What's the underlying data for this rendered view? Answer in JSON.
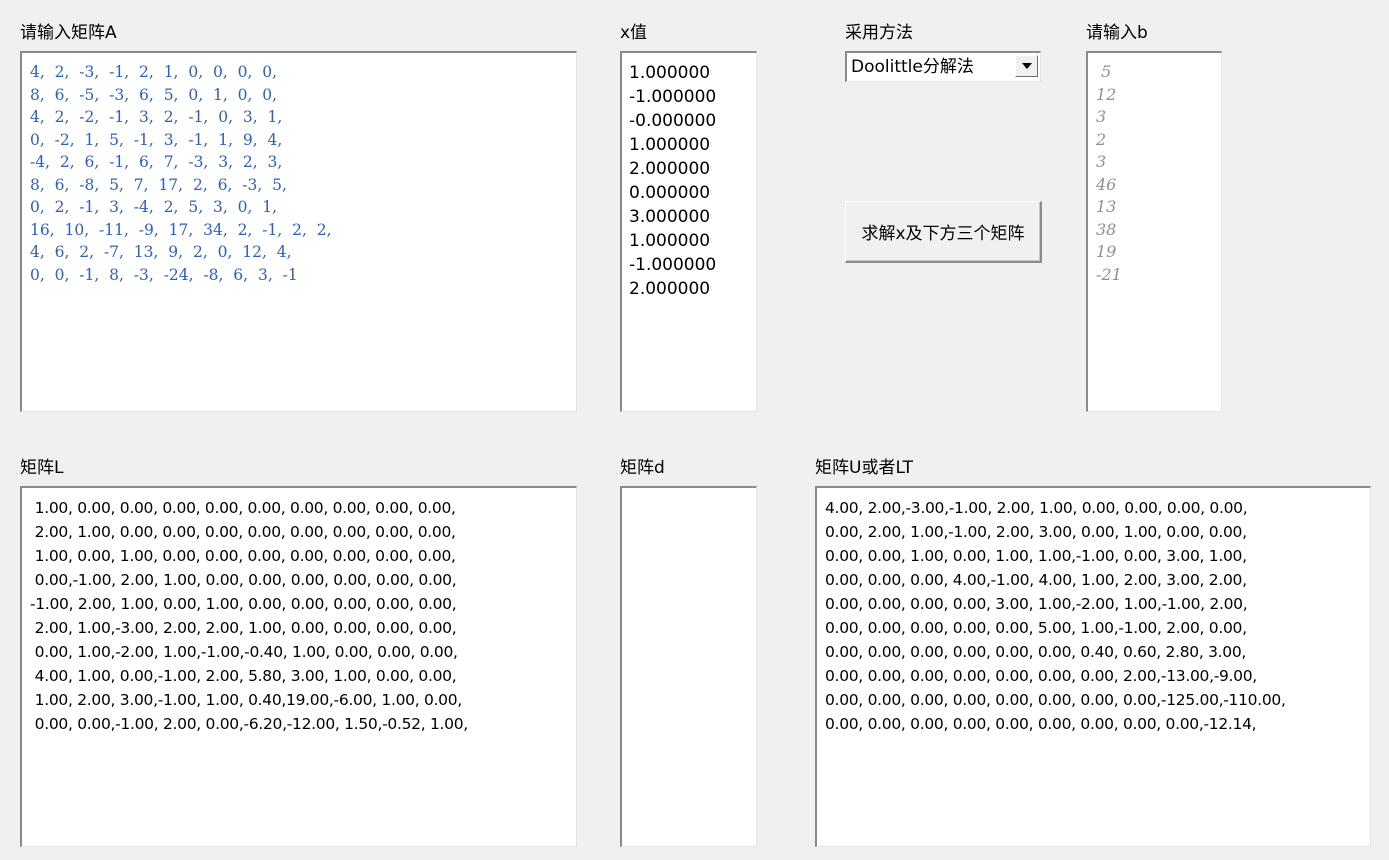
{
  "labels": {
    "matrix_a": "请输入矩阵A",
    "x_values": "x值",
    "method": "采用方法",
    "vector_b": "请输入b",
    "matrix_l": "矩阵L",
    "matrix_d": "矩阵d",
    "matrix_u": "矩阵U或者LT"
  },
  "method_select": {
    "value": "Doolittle分解法"
  },
  "solve_button": {
    "label": "求解x及下方三个矩阵"
  },
  "matrix_a_lines": [
    "4,  2,  -3,  -1,  2,  1,  0,  0,  0,  0,",
    "8,  6,  -5,  -3,  6,  5,  0,  1,  0,  0,",
    "4,  2,  -2,  -1,  3,  2,  -1,  0,  3,  1,",
    "0,  -2,  1,  5,  -1,  3,  -1,  1,  9,  4,",
    "-4,  2,  6,  -1,  6,  7,  -3,  3,  2,  3,",
    "8,  6,  -8,  5,  7,  17,  2,  6,  -3,  5,",
    "0,  2,  -1,  3,  -4,  2,  5,  3,  0,  1,",
    "16,  10,  -11,  -9,  17,  34,  2,  -1,  2,  2,",
    "4,  6,  2,  -7,  13,  9,  2,  0,  12,  4,",
    "0,  0,  -1,  8,  -3,  -24,  -8,  6,  3,  -1"
  ],
  "x_values": [
    "1.000000",
    "-1.000000",
    "-0.000000",
    "1.000000",
    "2.000000",
    "0.000000",
    "3.000000",
    "1.000000",
    "-1.000000",
    "2.000000"
  ],
  "b_values": [
    " 5",
    "12",
    "3",
    "2",
    "3",
    "46",
    "13",
    "38",
    "19",
    "-21"
  ],
  "matrix_l_lines": [
    " 1.00, 0.00, 0.00, 0.00, 0.00, 0.00, 0.00, 0.00, 0.00, 0.00,",
    " 2.00, 1.00, 0.00, 0.00, 0.00, 0.00, 0.00, 0.00, 0.00, 0.00,",
    " 1.00, 0.00, 1.00, 0.00, 0.00, 0.00, 0.00, 0.00, 0.00, 0.00,",
    " 0.00,-1.00, 2.00, 1.00, 0.00, 0.00, 0.00, 0.00, 0.00, 0.00,",
    "-1.00, 2.00, 1.00, 0.00, 1.00, 0.00, 0.00, 0.00, 0.00, 0.00,",
    " 2.00, 1.00,-3.00, 2.00, 2.00, 1.00, 0.00, 0.00, 0.00, 0.00,",
    " 0.00, 1.00,-2.00, 1.00,-1.00,-0.40, 1.00, 0.00, 0.00, 0.00,",
    " 4.00, 1.00, 0.00,-1.00, 2.00, 5.80, 3.00, 1.00, 0.00, 0.00,",
    " 1.00, 2.00, 3.00,-1.00, 1.00, 0.40,19.00,-6.00, 1.00, 0.00,",
    " 0.00, 0.00,-1.00, 2.00, 0.00,-6.20,-12.00, 1.50,-0.52, 1.00,"
  ],
  "matrix_d_lines": [],
  "matrix_u_lines": [
    "4.00, 2.00,-3.00,-1.00, 2.00, 1.00, 0.00, 0.00, 0.00, 0.00,",
    "0.00, 2.00, 1.00,-1.00, 2.00, 3.00, 0.00, 1.00, 0.00, 0.00,",
    "0.00, 0.00, 1.00, 0.00, 1.00, 1.00,-1.00, 0.00, 3.00, 1.00,",
    "0.00, 0.00, 0.00, 4.00,-1.00, 4.00, 1.00, 2.00, 3.00, 2.00,",
    "0.00, 0.00, 0.00, 0.00, 3.00, 1.00,-2.00, 1.00,-1.00, 2.00,",
    "0.00, 0.00, 0.00, 0.00, 0.00, 5.00, 1.00,-1.00, 2.00, 0.00,",
    "0.00, 0.00, 0.00, 0.00, 0.00, 0.00, 0.40, 0.60, 2.80, 3.00,",
    "0.00, 0.00, 0.00, 0.00, 0.00, 0.00, 0.00, 2.00,-13.00,-9.00,",
    "0.00, 0.00, 0.00, 0.00, 0.00, 0.00, 0.00, 0.00,-125.00,-110.00,",
    "0.00, 0.00, 0.00, 0.00, 0.00, 0.00, 0.00, 0.00, 0.00,-12.14,"
  ]
}
